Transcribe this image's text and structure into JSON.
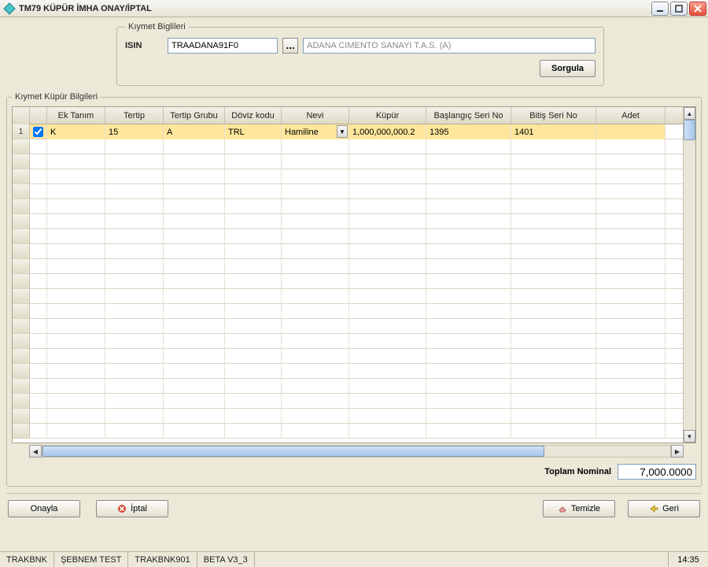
{
  "window": {
    "title": "TM79 KÜPÜR İMHA ONAY/İPTAL"
  },
  "kiymet": {
    "legend": "Kıymet Biglileri",
    "isin_label": "ISIN",
    "isin_value": "TRAADANA91F0",
    "ellipsis": "...",
    "company": "ADANA CIMENTO SANAYI T.A.S. (A)",
    "sorgula": "Sorgula"
  },
  "grid": {
    "legend": "Kıymet Küpür Bilgileri",
    "columns": {
      "ek": "Ek Tanım",
      "tertip": "Tertip",
      "grubu": "Tertip Grubu",
      "doviz": "Döviz kodu",
      "nevi": "Nevi",
      "kupur": "Küpür",
      "basl": "Başlangıç Seri No",
      "bitis": "Bitiş Seri No",
      "adet": "Adet"
    },
    "row1": {
      "num": "1",
      "checked": true,
      "ek": "K",
      "tertip": "15",
      "grubu": "A",
      "doviz": "TRL",
      "nevi": "Hamiline",
      "kupur": "1,000,000,000.2",
      "basl": "1395",
      "bitis": "1401",
      "adet": ""
    }
  },
  "totals": {
    "label": "Toplam Nominal",
    "value": "7,000.0000"
  },
  "actions": {
    "onayla": "Onayla",
    "iptal": "İptal",
    "temizle": "Temizle",
    "geri": "Geri"
  },
  "status": {
    "s1": "TRAKBNK",
    "s2": "ŞEBNEM TEST",
    "s3": "TRAKBNK901",
    "s4": "BETA V3_3",
    "time": "14:35"
  }
}
